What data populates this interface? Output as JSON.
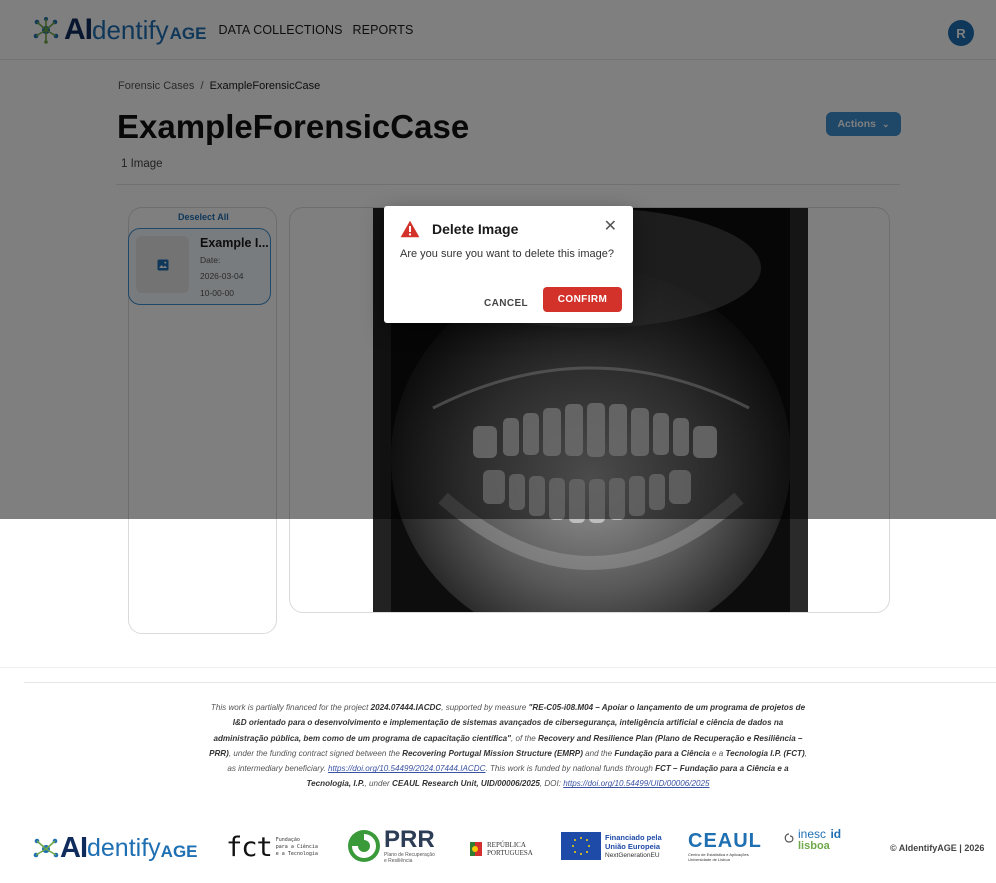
{
  "header": {
    "brand": {
      "ai": "AI",
      "dentify": "dentify",
      "age": "AGE"
    },
    "nav": [
      "DATA COLLECTIONS",
      "REPORTS"
    ],
    "avatar_initial": "R"
  },
  "breadcrumb": {
    "parent": "Forensic Cases",
    "separator": "/",
    "current": "ExampleForensicCase"
  },
  "page": {
    "title": "ExampleForensicCase",
    "image_count": "1 Image",
    "actions_label": "Actions"
  },
  "sidebar": {
    "deselect_all": "Deselect All",
    "images": [
      {
        "name": "Example I...",
        "date_label": "Date:",
        "date": "2026-03-04",
        "time": "10-00-00"
      }
    ]
  },
  "dialog": {
    "title": "Delete Image",
    "message": "Are you sure you want to delete this image?",
    "cancel": "CANCEL",
    "confirm": "CONFIRM",
    "close_icon": "close-icon",
    "warning_icon": "warning-icon"
  },
  "footer": {
    "funding": {
      "t1": "This work is partially financed for the project ",
      "b1": "2024.07444.IACDC",
      "t2": ", supported by measure ",
      "b2": "\"RE-C05-i08.M04 – Apoiar o lançamento de um programa de projetos de I&D orientado para o desenvolvimento e implementação de sistemas avançados de cibersegurança, inteligência artificial e ciência de dados na administração pública, bem como de um programa de capacitação científica\"",
      "t3": ", of the ",
      "b3": "Recovery and Resilience Plan (Plano de Recuperação e Resiliência – PRR)",
      "t4": ", under the funding contract signed between the ",
      "b4": "Recovering Portugal Mission Structure (EMRP)",
      "t5": " and the ",
      "b5": "Fundação para a Ciência",
      "t6": " e a ",
      "b6": "Tecnologia I.P. (FCT)",
      "t7": ", as intermediary beneficiary. ",
      "link1": "https://doi.org/10.54499/2024.07444.IACDC",
      "t8": ". This work is funded by national funds through ",
      "b7": "FCT – Fundação para a Ciência e a Tecnologia, I.P.",
      "t9": ", under ",
      "b8": "CEAUL Research Unit, UID/00006/2025",
      "t10": ", DOI: ",
      "link2": "https://doi.org/10.54499/UID/00006/2025"
    },
    "logos": {
      "fct_main": "fct",
      "fct_sub1": "Fundação",
      "fct_sub2": "para a Ciência",
      "fct_sub3": "e a Tecnologia",
      "prr_main": "PRR",
      "prr_sub1": "Plano de Recuperação",
      "prr_sub2": "e Resiliência",
      "republica1": "REPÚBLICA",
      "republica2": "PORTUGUESA",
      "eu1": "Financiado pela",
      "eu2": "União Europeia",
      "eu3": "NextGenerationEU",
      "ceaul": "CEAUL",
      "ceaul_sub": "Centro de Estatística e Aplicações",
      "ceaul_sub2": "Universidade de Lisboa",
      "inesc": "inesc",
      "id": "id",
      "lisboa": "lisboa"
    },
    "copyright": "© AIdentifyAGE | 2026"
  },
  "colors": {
    "brand_dark": "#0f2c5c",
    "brand_blue": "#1f6fb3",
    "actions": "#3d8fd1",
    "confirm": "#d3322b"
  }
}
